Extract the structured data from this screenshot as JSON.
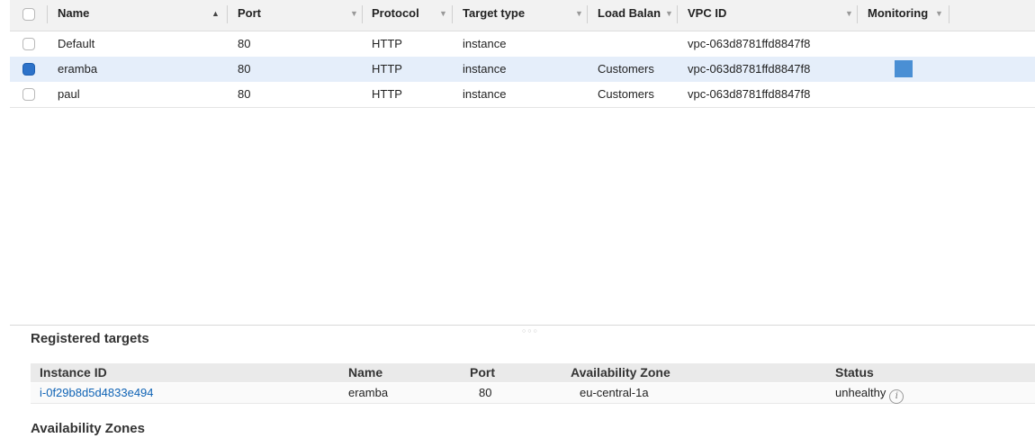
{
  "columns": {
    "name": "Name",
    "port": "Port",
    "protocol": "Protocol",
    "target_type": "Target type",
    "load_balancer": "Load Balan",
    "vpc_id": "VPC ID",
    "monitoring": "Monitoring"
  },
  "rows": [
    {
      "name": "Default",
      "port": "80",
      "protocol": "HTTP",
      "target_type": "instance",
      "load_balancer": "",
      "vpc_id": "vpc-063d8781ffd8847f8",
      "checked": false
    },
    {
      "name": "eramba",
      "port": "80",
      "protocol": "HTTP",
      "target_type": "instance",
      "load_balancer": "Customers",
      "vpc_id": "vpc-063d8781ffd8847f8",
      "checked": true
    },
    {
      "name": "paul",
      "port": "80",
      "protocol": "HTTP",
      "target_type": "instance",
      "load_balancer": "Customers",
      "vpc_id": "vpc-063d8781ffd8847f8",
      "checked": false
    }
  ],
  "registered_targets": {
    "title": "Registered targets",
    "headers": {
      "instance_id": "Instance ID",
      "name": "Name",
      "port": "Port",
      "az": "Availability Zone",
      "status": "Status"
    },
    "rows": [
      {
        "instance_id": "i-0f29b8d5d4833e494",
        "name": "eramba",
        "port": "80",
        "az": "eu-central-1a",
        "status": "unhealthy",
        "status_icon": "info-icon"
      }
    ]
  },
  "availability_zones": {
    "title": "Availability Zones"
  },
  "colors": {
    "selected_row": "#e5eefa",
    "accent": "#2d72c9",
    "link": "#0f63b5"
  }
}
